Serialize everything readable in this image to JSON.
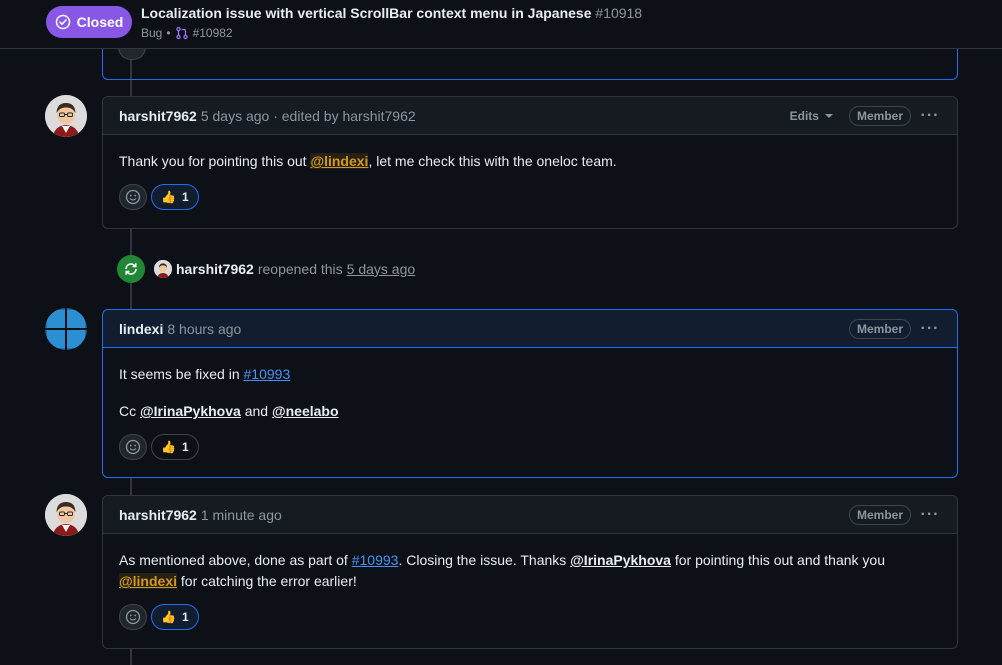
{
  "issue": {
    "state": "Closed",
    "title": "Localization issue with vertical ScrollBar context menu in Japanese",
    "number": "#10918",
    "label": "Bug",
    "separator": "•",
    "linked_pr": "#10982"
  },
  "comments": [
    {
      "author": "harshit7962",
      "meta": "5 days ago · edited by harshit7962",
      "edits_label": "Edits",
      "role": "Member",
      "menu": "···",
      "body": {
        "t1": "Thank you for pointing this out ",
        "mention": "@lindexi",
        "t2": ", let me check this with the oneloc team."
      },
      "reactions": [
        {
          "emoji": "👍",
          "count": "1"
        }
      ]
    },
    {
      "author": "lindexi",
      "meta": "8 hours ago",
      "role": "Member",
      "menu": "···",
      "body": {
        "p1_text": "It seems be fixed in ",
        "p1_link": "#10993",
        "p2_text": "Cc ",
        "p2_m1": "@IrinaPykhova",
        "p2_and": " and ",
        "p2_m2": "@neelabo"
      },
      "reactions": [
        {
          "emoji": "👍",
          "count": "1"
        }
      ]
    },
    {
      "author": "harshit7962",
      "meta": "1 minute ago",
      "role": "Member",
      "menu": "···",
      "body": {
        "t1": "As mentioned above, done as part of ",
        "link": "#10993",
        "t2": ". Closing the issue. Thanks ",
        "m1": "@IrinaPykhova",
        "t3": " for pointing this out and thank you ",
        "m2": "@lindexi",
        "t4": " for catching the error earlier!"
      },
      "reactions": [
        {
          "emoji": "👍",
          "count": "1"
        }
      ]
    }
  ],
  "event": {
    "actor": "harshit7962",
    "action": "reopened this",
    "when": "5 days ago"
  },
  "icons": {
    "state": "circle-check-icon",
    "pr": "git-pull-request-icon",
    "reopen": "sync-icon",
    "reaction": "smiley-icon"
  },
  "colors": {
    "closed": "#8957e5",
    "reopened": "#238636",
    "link": "#4493f8",
    "mention_highlight": "#d29922",
    "accent_border": "#1f6feb"
  }
}
